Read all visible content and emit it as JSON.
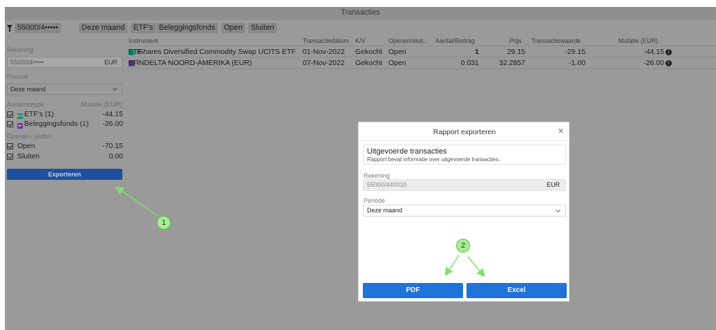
{
  "window": {
    "title": "Transacties"
  },
  "filter_chips": [
    "55000/4•••••",
    "Deze maand",
    "ETF's",
    "Beleggingsfonds",
    "Open",
    "Sluiten"
  ],
  "sidebar": {
    "account_label": "Rekening",
    "account_value": "55000/4•••••",
    "account_currency": "EUR",
    "period_label": "Periode",
    "period_value": "Deze maand",
    "type_header": "Aanwinsttype",
    "type_mutation_header": "Mutatie (EUR)",
    "types": [
      {
        "badge": "ETF",
        "label": "ETF's (1)",
        "value": "-44.15",
        "color": "#1d8f78"
      },
      {
        "badge": "BF",
        "label": "Beleggingsfonds (1)",
        "value": "-26.00",
        "color": "#6b3aa0"
      }
    ],
    "open_close_header": "Openen / sluiten",
    "open_close": [
      {
        "label": "Open",
        "value": "-70.15"
      },
      {
        "label": "Sluiten",
        "value": "0.00"
      }
    ],
    "export_button": "Exporteren"
  },
  "table": {
    "headers": {
      "instrument": "Instrument",
      "date": "Transactiedatum",
      "kv": "K/V",
      "open_close": "Openen/sluit...",
      "amount": "Aantal/Bedrag",
      "price": "Prijs",
      "value": "Transactiewaarde",
      "mutation": "Mutatie (EUR)"
    },
    "rows": [
      {
        "badge": "ETF",
        "instrument": "iShares Diversified Commodity Swap UCITS ETF",
        "date": "01-Nov-2022",
        "kv": "Gekocht",
        "open_close": "Open",
        "amount": "1",
        "price": "29.15",
        "value": "-29.15",
        "mutation": "-44.15"
      },
      {
        "badge": "BF",
        "instrument": "INDELTA NOORD-AMERIKA (EUR)",
        "date": "07-Nov-2022",
        "kv": "Gekocht",
        "open_close": "Open",
        "amount": "0.031",
        "price": "32.2857",
        "value": "-1.00",
        "mutation": "-26.00"
      }
    ]
  },
  "modal": {
    "title": "Rapport exporteren",
    "report_title": "Uitgevoerde transacties",
    "report_desc": "Rapport bevat informatie over uitgevoerde transacties.",
    "account_label": "Rekening",
    "account_value": "55000/440010",
    "account_currency": "EUR",
    "period_label": "Periode",
    "period_value": "Deze maand",
    "pdf_button": "PDF",
    "excel_button": "Excel"
  },
  "callouts": [
    "1",
    "2"
  ],
  "colors": {
    "accent": "#1f73d9",
    "callout": "#a5ee94",
    "arrow": "#7de06a"
  }
}
